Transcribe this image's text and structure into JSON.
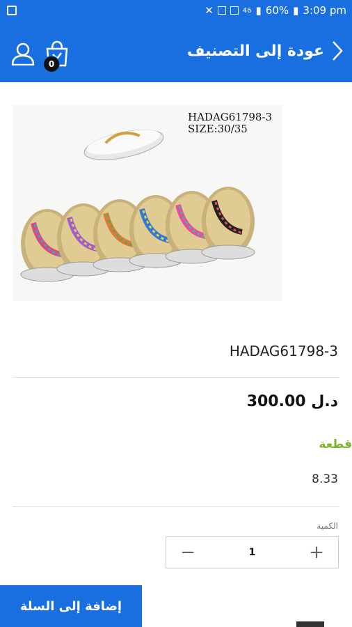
{
  "status_bar": {
    "battery": "60%",
    "time": "3:09 pm",
    "signal_label": "46"
  },
  "header": {
    "back_label": "عودة إلى التصنيف",
    "cart_count": "0",
    "bar_color": "#1a6fe0"
  },
  "product": {
    "image_code_line1": "HADAG61798-3",
    "image_code_line2": "SIZE:30/35",
    "sku": "HADAG61798-3",
    "price": "300.00 د.ل",
    "unit_label": "قطعة",
    "unit_price": "8.33"
  },
  "quantity": {
    "label": "الكمية",
    "value": "1",
    "minus": "−",
    "plus": "+"
  },
  "actions": {
    "add_to_cart": "إضافة إلى السلة"
  }
}
